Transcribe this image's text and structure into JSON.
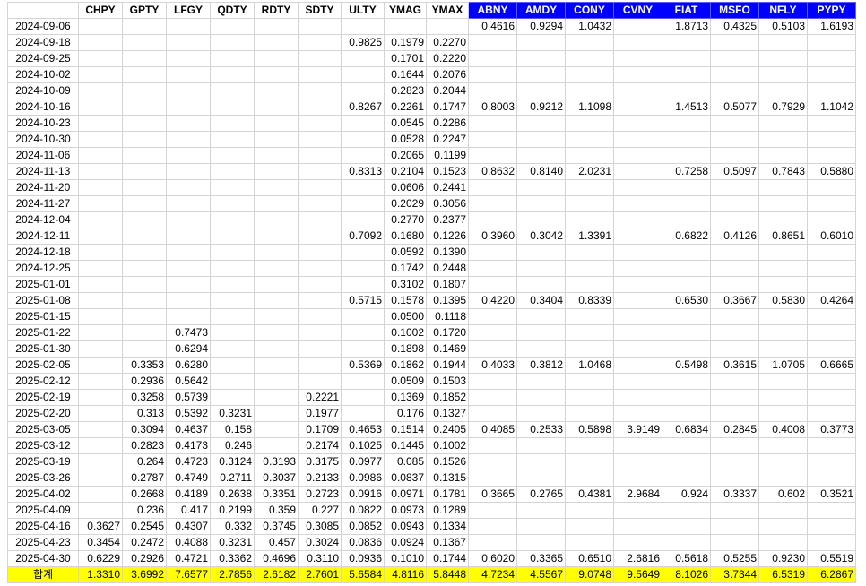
{
  "colors": {
    "blue_header": "#0000ff",
    "total_row": "#ffff00",
    "grid": "#d4d4d4"
  },
  "headers": [
    "",
    "CHPY",
    "GPTY",
    "LFGY",
    "QDTY",
    "RDTY",
    "SDTY",
    "ULTY",
    "YMAG",
    "YMAX",
    "ABNY",
    "AMDY",
    "CONY",
    "CVNY",
    "FIAT",
    "MSFO",
    "NFLY",
    "PYPY"
  ],
  "blue_from": 10,
  "rows": [
    [
      "2024-09-06",
      "",
      "",
      "",
      "",
      "",
      "",
      "",
      "",
      "",
      "0.4616",
      "0.9294",
      "1.0432",
      "",
      "1.8713",
      "0.4325",
      "0.5103",
      "1.6193"
    ],
    [
      "2024-09-18",
      "",
      "",
      "",
      "",
      "",
      "",
      "0.9825",
      "0.1979",
      "0.2270",
      "",
      "",
      "",
      "",
      "",
      "",
      "",
      ""
    ],
    [
      "2024-09-25",
      "",
      "",
      "",
      "",
      "",
      "",
      "",
      "0.1701",
      "0.2220",
      "",
      "",
      "",
      "",
      "",
      "",
      "",
      ""
    ],
    [
      "2024-10-02",
      "",
      "",
      "",
      "",
      "",
      "",
      "",
      "0.1644",
      "0.2076",
      "",
      "",
      "",
      "",
      "",
      "",
      "",
      ""
    ],
    [
      "2024-10-09",
      "",
      "",
      "",
      "",
      "",
      "",
      "",
      "0.2823",
      "0.2044",
      "",
      "",
      "",
      "",
      "",
      "",
      "",
      ""
    ],
    [
      "2024-10-16",
      "",
      "",
      "",
      "",
      "",
      "",
      "0.8267",
      "0.2261",
      "0.1747",
      "0.8003",
      "0.9212",
      "1.1098",
      "",
      "1.4513",
      "0.5077",
      "0.7929",
      "1.1042"
    ],
    [
      "2024-10-23",
      "",
      "",
      "",
      "",
      "",
      "",
      "",
      "0.0545",
      "0.2286",
      "",
      "",
      "",
      "",
      "",
      "",
      "",
      ""
    ],
    [
      "2024-10-30",
      "",
      "",
      "",
      "",
      "",
      "",
      "",
      "0.0528",
      "0.2247",
      "",
      "",
      "",
      "",
      "",
      "",
      "",
      ""
    ],
    [
      "2024-11-06",
      "",
      "",
      "",
      "",
      "",
      "",
      "",
      "0.2065",
      "0.1199",
      "",
      "",
      "",
      "",
      "",
      "",
      "",
      ""
    ],
    [
      "2024-11-13",
      "",
      "",
      "",
      "",
      "",
      "",
      "0.8313",
      "0.2104",
      "0.1523",
      "0.8632",
      "0.8140",
      "2.0231",
      "",
      "0.7258",
      "0.5097",
      "0.7843",
      "0.5880"
    ],
    [
      "2024-11-20",
      "",
      "",
      "",
      "",
      "",
      "",
      "",
      "0.0606",
      "0.2441",
      "",
      "",
      "",
      "",
      "",
      "",
      "",
      ""
    ],
    [
      "2024-11-27",
      "",
      "",
      "",
      "",
      "",
      "",
      "",
      "0.2029",
      "0.3056",
      "",
      "",
      "",
      "",
      "",
      "",
      "",
      ""
    ],
    [
      "2024-12-04",
      "",
      "",
      "",
      "",
      "",
      "",
      "",
      "0.2770",
      "0.2377",
      "",
      "",
      "",
      "",
      "",
      "",
      "",
      ""
    ],
    [
      "2024-12-11",
      "",
      "",
      "",
      "",
      "",
      "",
      "0.7092",
      "0.1680",
      "0.1226",
      "0.3960",
      "0.3042",
      "1.3391",
      "",
      "0.6822",
      "0.4126",
      "0.8651",
      "0.6010"
    ],
    [
      "2024-12-18",
      "",
      "",
      "",
      "",
      "",
      "",
      "",
      "0.0592",
      "0.1390",
      "",
      "",
      "",
      "",
      "",
      "",
      "",
      ""
    ],
    [
      "2024-12-25",
      "",
      "",
      "",
      "",
      "",
      "",
      "",
      "0.1742",
      "0.2448",
      "",
      "",
      "",
      "",
      "",
      "",
      "",
      ""
    ],
    [
      "2025-01-01",
      "",
      "",
      "",
      "",
      "",
      "",
      "",
      "0.3102",
      "0.1807",
      "",
      "",
      "",
      "",
      "",
      "",
      "",
      ""
    ],
    [
      "2025-01-08",
      "",
      "",
      "",
      "",
      "",
      "",
      "0.5715",
      "0.1578",
      "0.1395",
      "0.4220",
      "0.3404",
      "0.8339",
      "",
      "0.6530",
      "0.3667",
      "0.5830",
      "0.4264"
    ],
    [
      "2025-01-15",
      "",
      "",
      "",
      "",
      "",
      "",
      "",
      "0.0500",
      "0.1118",
      "",
      "",
      "",
      "",
      "",
      "",
      "",
      ""
    ],
    [
      "2025-01-22",
      "",
      "",
      "0.7473",
      "",
      "",
      "",
      "",
      "0.1002",
      "0.1720",
      "",
      "",
      "",
      "",
      "",
      "",
      "",
      ""
    ],
    [
      "2025-01-30",
      "",
      "",
      "0.6294",
      "",
      "",
      "",
      "",
      "0.1898",
      "0.1469",
      "",
      "",
      "",
      "",
      "",
      "",
      "",
      ""
    ],
    [
      "2025-02-05",
      "",
      "0.3353",
      "0.6280",
      "",
      "",
      "",
      "0.5369",
      "0.1862",
      "0.1944",
      "0.4033",
      "0.3812",
      "1.0468",
      "",
      "0.5498",
      "0.3615",
      "1.0705",
      "0.6665"
    ],
    [
      "2025-02-12",
      "",
      "0.2936",
      "0.5642",
      "",
      "",
      "",
      "",
      "0.0509",
      "0.1503",
      "",
      "",
      "",
      "",
      "",
      "",
      "",
      ""
    ],
    [
      "2025-02-19",
      "",
      "0.3258",
      "0.5739",
      "",
      "",
      "0.2221",
      "",
      "0.1369",
      "0.1852",
      "",
      "",
      "",
      "",
      "",
      "",
      "",
      ""
    ],
    [
      "2025-02-20",
      "",
      "0.313",
      "0.5392",
      "0.3231",
      "",
      "0.1977",
      "",
      "0.176",
      "0.1327",
      "",
      "",
      "",
      "",
      "",
      "",
      "",
      ""
    ],
    [
      "2025-03-05",
      "",
      "0.3094",
      "0.4637",
      "0.158",
      "",
      "0.1709",
      "0.4653",
      "0.1514",
      "0.2405",
      "0.4085",
      "0.2533",
      "0.5898",
      "3.9149",
      "0.6834",
      "0.2845",
      "0.4008",
      "0.3773"
    ],
    [
      "2025-03-12",
      "",
      "0.2823",
      "0.4173",
      "0.246",
      "",
      "0.2174",
      "0.1025",
      "0.1445",
      "0.1002",
      "",
      "",
      "",
      "",
      "",
      "",
      "",
      ""
    ],
    [
      "2025-03-19",
      "",
      "0.264",
      "0.4723",
      "0.3124",
      "0.3193",
      "0.3175",
      "0.0977",
      "0.085",
      "0.1526",
      "",
      "",
      "",
      "",
      "",
      "",
      "",
      ""
    ],
    [
      "2025-03-26",
      "",
      "0.2787",
      "0.4749",
      "0.2711",
      "0.3037",
      "0.2133",
      "0.0986",
      "0.0837",
      "0.1315",
      "",
      "",
      "",
      "",
      "",
      "",
      "",
      ""
    ],
    [
      "2025-04-02",
      "",
      "0.2668",
      "0.4189",
      "0.2638",
      "0.3351",
      "0.2723",
      "0.0916",
      "0.0971",
      "0.1781",
      "0.3665",
      "0.2765",
      "0.4381",
      "2.9684",
      "0.924",
      "0.3337",
      "0.602",
      "0.3521"
    ],
    [
      "2025-04-09",
      "",
      "0.236",
      "0.417",
      "0.2199",
      "0.359",
      "0.227",
      "0.0822",
      "0.0973",
      "0.1289",
      "",
      "",
      "",
      "",
      "",
      "",
      "",
      ""
    ],
    [
      "2025-04-16",
      "0.3627",
      "0.2545",
      "0.4307",
      "0.332",
      "0.3745",
      "0.3085",
      "0.0852",
      "0.0943",
      "0.1334",
      "",
      "",
      "",
      "",
      "",
      "",
      "",
      ""
    ],
    [
      "2025-04-23",
      "0.3454",
      "0.2472",
      "0.4088",
      "0.3231",
      "0.457",
      "0.3024",
      "0.0836",
      "0.0924",
      "0.1367",
      "",
      "",
      "",
      "",
      "",
      "",
      "",
      ""
    ],
    [
      "2025-04-30",
      "0.6229",
      "0.2926",
      "0.4721",
      "0.3362",
      "0.4696",
      "0.3110",
      "0.0936",
      "0.1010",
      "0.1744",
      "0.6020",
      "0.3365",
      "0.6510",
      "2.6816",
      "0.5618",
      "0.5255",
      "0.9230",
      "0.5519"
    ]
  ],
  "total": [
    "합계",
    "1.3310",
    "3.6992",
    "7.6577",
    "2.7856",
    "2.6182",
    "2.7601",
    "5.6584",
    "4.8116",
    "5.8448",
    "4.7234",
    "4.5567",
    "9.0748",
    "9.5649",
    "8.1026",
    "3.7344",
    "6.5319",
    "6.2867"
  ]
}
